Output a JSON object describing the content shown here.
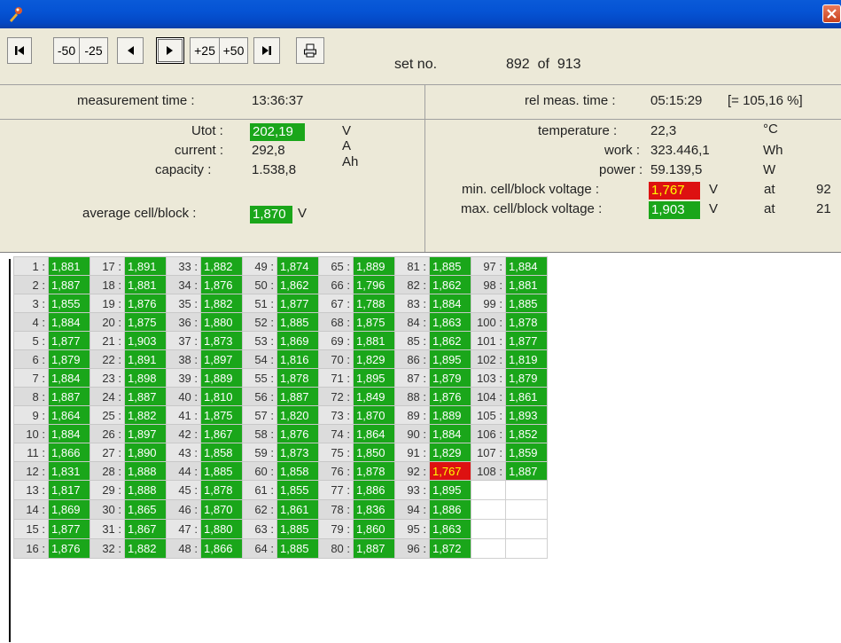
{
  "window": {
    "close_label": "×"
  },
  "toolbar": {
    "first": "K",
    "minus50": "-50",
    "minus25": "-25",
    "prev": "◀",
    "next": "▶",
    "plus25": "+25",
    "plus50": "+50",
    "last": "H",
    "print": "🖶"
  },
  "set": {
    "label": "set no.",
    "current": "892",
    "of": "of",
    "total": "913"
  },
  "header": {
    "meas_time_label": "measurement time :",
    "meas_time": "13:36:37",
    "rel_label": "rel meas. time :",
    "rel_time": "05:15:29",
    "rel_pct": "[= 105,16 %]"
  },
  "left": {
    "utot_label": "Utot :",
    "utot": "202,19",
    "utot_unit": "V",
    "current_label": "current :",
    "current": "292,8",
    "current_unit": "A",
    "capacity_label": "capacity :",
    "capacity": "1.538,8",
    "capacity_unit": "Ah",
    "avg_label": "average cell/block :",
    "avg": "1,870",
    "avg_unit": "V"
  },
  "right": {
    "temp_label": "temperature :",
    "temp": "22,3",
    "temp_unit": "°C",
    "work_label": "work :",
    "work": "323.446,1",
    "work_unit": "Wh",
    "power_label": "power :",
    "power": "59.139,5",
    "power_unit": "W",
    "min_label": "min. cell/block voltage :",
    "min": "1,767",
    "min_unit": "V",
    "min_at": "at",
    "min_idx": "92",
    "max_label": "max. cell/block voltage :",
    "max": "1,903",
    "max_unit": "V",
    "max_at": "at",
    "max_idx": "21"
  },
  "cells": [
    {
      "n": "1 :",
      "v": "1,881"
    },
    {
      "n": "2 :",
      "v": "1,887"
    },
    {
      "n": "3 :",
      "v": "1,855"
    },
    {
      "n": "4 :",
      "v": "1,884"
    },
    {
      "n": "5 :",
      "v": "1,877"
    },
    {
      "n": "6 :",
      "v": "1,879"
    },
    {
      "n": "7 :",
      "v": "1,884"
    },
    {
      "n": "8 :",
      "v": "1,887"
    },
    {
      "n": "9 :",
      "v": "1,864"
    },
    {
      "n": "10 :",
      "v": "1,884"
    },
    {
      "n": "11 :",
      "v": "1,866"
    },
    {
      "n": "12 :",
      "v": "1,831"
    },
    {
      "n": "13 :",
      "v": "1,817"
    },
    {
      "n": "14 :",
      "v": "1,869"
    },
    {
      "n": "15 :",
      "v": "1,877"
    },
    {
      "n": "16 :",
      "v": "1,876"
    },
    {
      "n": "17 :",
      "v": "1,891"
    },
    {
      "n": "18 :",
      "v": "1,881"
    },
    {
      "n": "19 :",
      "v": "1,876"
    },
    {
      "n": "20 :",
      "v": "1,875"
    },
    {
      "n": "21 :",
      "v": "1,903"
    },
    {
      "n": "22 :",
      "v": "1,891"
    },
    {
      "n": "23 :",
      "v": "1,898"
    },
    {
      "n": "24 :",
      "v": "1,887"
    },
    {
      "n": "25 :",
      "v": "1,882"
    },
    {
      "n": "26 :",
      "v": "1,897"
    },
    {
      "n": "27 :",
      "v": "1,890"
    },
    {
      "n": "28 :",
      "v": "1,888"
    },
    {
      "n": "29 :",
      "v": "1,888"
    },
    {
      "n": "30 :",
      "v": "1,865"
    },
    {
      "n": "31 :",
      "v": "1,867"
    },
    {
      "n": "32 :",
      "v": "1,882"
    },
    {
      "n": "33 :",
      "v": "1,882"
    },
    {
      "n": "34 :",
      "v": "1,876"
    },
    {
      "n": "35 :",
      "v": "1,882"
    },
    {
      "n": "36 :",
      "v": "1,880"
    },
    {
      "n": "37 :",
      "v": "1,873"
    },
    {
      "n": "38 :",
      "v": "1,897"
    },
    {
      "n": "39 :",
      "v": "1,889"
    },
    {
      "n": "40 :",
      "v": "1,810"
    },
    {
      "n": "41 :",
      "v": "1,875"
    },
    {
      "n": "42 :",
      "v": "1,867"
    },
    {
      "n": "43 :",
      "v": "1,858"
    },
    {
      "n": "44 :",
      "v": "1,885"
    },
    {
      "n": "45 :",
      "v": "1,878"
    },
    {
      "n": "46 :",
      "v": "1,870"
    },
    {
      "n": "47 :",
      "v": "1,880"
    },
    {
      "n": "48 :",
      "v": "1,866"
    },
    {
      "n": "49 :",
      "v": "1,874"
    },
    {
      "n": "50 :",
      "v": "1,862"
    },
    {
      "n": "51 :",
      "v": "1,877"
    },
    {
      "n": "52 :",
      "v": "1,885"
    },
    {
      "n": "53 :",
      "v": "1,869"
    },
    {
      "n": "54 :",
      "v": "1,816"
    },
    {
      "n": "55 :",
      "v": "1,878"
    },
    {
      "n": "56 :",
      "v": "1,887"
    },
    {
      "n": "57 :",
      "v": "1,820"
    },
    {
      "n": "58 :",
      "v": "1,876"
    },
    {
      "n": "59 :",
      "v": "1,873"
    },
    {
      "n": "60 :",
      "v": "1,858"
    },
    {
      "n": "61 :",
      "v": "1,855"
    },
    {
      "n": "62 :",
      "v": "1,861"
    },
    {
      "n": "63 :",
      "v": "1,885"
    },
    {
      "n": "64 :",
      "v": "1,885"
    },
    {
      "n": "65 :",
      "v": "1,889"
    },
    {
      "n": "66 :",
      "v": "1,796"
    },
    {
      "n": "67 :",
      "v": "1,788"
    },
    {
      "n": "68 :",
      "v": "1,875"
    },
    {
      "n": "69 :",
      "v": "1,881"
    },
    {
      "n": "70 :",
      "v": "1,829"
    },
    {
      "n": "71 :",
      "v": "1,895"
    },
    {
      "n": "72 :",
      "v": "1,849"
    },
    {
      "n": "73 :",
      "v": "1,870"
    },
    {
      "n": "74 :",
      "v": "1,864"
    },
    {
      "n": "75 :",
      "v": "1,850"
    },
    {
      "n": "76 :",
      "v": "1,878"
    },
    {
      "n": "77 :",
      "v": "1,886"
    },
    {
      "n": "78 :",
      "v": "1,836"
    },
    {
      "n": "79 :",
      "v": "1,860"
    },
    {
      "n": "80 :",
      "v": "1,887"
    },
    {
      "n": "81 :",
      "v": "1,885"
    },
    {
      "n": "82 :",
      "v": "1,862"
    },
    {
      "n": "83 :",
      "v": "1,884"
    },
    {
      "n": "84 :",
      "v": "1,863"
    },
    {
      "n": "85 :",
      "v": "1,862"
    },
    {
      "n": "86 :",
      "v": "1,895"
    },
    {
      "n": "87 :",
      "v": "1,879"
    },
    {
      "n": "88 :",
      "v": "1,876"
    },
    {
      "n": "89 :",
      "v": "1,889"
    },
    {
      "n": "90 :",
      "v": "1,884"
    },
    {
      "n": "91 :",
      "v": "1,829"
    },
    {
      "n": "92 :",
      "v": "1,767"
    },
    {
      "n": "93 :",
      "v": "1,895"
    },
    {
      "n": "94 :",
      "v": "1,886"
    },
    {
      "n": "95 :",
      "v": "1,863"
    },
    {
      "n": "96 :",
      "v": "1,872"
    },
    {
      "n": "97 :",
      "v": "1,884"
    },
    {
      "n": "98 :",
      "v": "1,881"
    },
    {
      "n": "99 :",
      "v": "1,885"
    },
    {
      "n": "100 :",
      "v": "1,878"
    },
    {
      "n": "101 :",
      "v": "1,877"
    },
    {
      "n": "102 :",
      "v": "1,819"
    },
    {
      "n": "103 :",
      "v": "1,879"
    },
    {
      "n": "104 :",
      "v": "1,861"
    },
    {
      "n": "105 :",
      "v": "1,893"
    },
    {
      "n": "106 :",
      "v": "1,852"
    },
    {
      "n": "107 :",
      "v": "1,859"
    },
    {
      "n": "108 :",
      "v": "1,887"
    }
  ],
  "colors": {
    "ok": "#1aa61a",
    "min": "#dd1111",
    "min_text": "#ffff00"
  },
  "min_cell": "92 :"
}
